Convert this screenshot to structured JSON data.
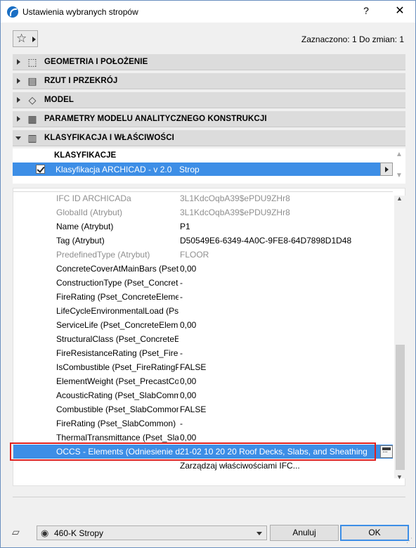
{
  "window": {
    "title": "Ustawienia wybranych stropów",
    "help": "?",
    "close": "✕"
  },
  "toolbar": {
    "favorites_icon": "star-icon",
    "selected_info": "Zaznaczono: 1 Do zmian: 1"
  },
  "panels": [
    {
      "label": "GEOMETRIA I POŁOŻENIE",
      "icon": "geometry-icon",
      "expanded": false
    },
    {
      "label": "RZUT I PRZEKRÓJ",
      "icon": "floorplan-icon",
      "expanded": false
    },
    {
      "label": "MODEL",
      "icon": "model-icon",
      "expanded": false
    },
    {
      "label": "PARAMETRY MODELU ANALITYCZNEGO KONSTRUKCJI",
      "icon": "analytical-icon",
      "expanded": false
    },
    {
      "label": "KLASYFIKACJA I WŁAŚCIWOŚCI",
      "icon": "properties-icon",
      "expanded": true
    }
  ],
  "classification": {
    "heading": "KLASYFIKACJE",
    "row": {
      "name": "Klasyfikacja ARCHICAD - v 2.0",
      "value": "Strop",
      "checked": true
    }
  },
  "properties": [
    {
      "name": "IFC ID ARCHICADa",
      "value": "3L1KdcOqbA39$ePDU9ZHr8",
      "disabled": true
    },
    {
      "name": "GlobalId (Atrybut)",
      "value": "3L1KdcOqbA39$ePDU9ZHr8",
      "disabled": true
    },
    {
      "name": "Name (Atrybut)",
      "value": "P1",
      "disabled": false
    },
    {
      "name": "Tag (Atrybut)",
      "value": "D50549E6-6349-4A0C-9FE8-64D7898D1D48",
      "disabled": false
    },
    {
      "name": "PredefinedType (Atrybut)",
      "value": "FLOOR",
      "disabled": true
    },
    {
      "name": "ConcreteCoverAtMainBars (Pset_ConcreteElementGeneral)",
      "value": " 0,00",
      "disabled": false
    },
    {
      "name": "ConstructionType (Pset_ConcreteElementGeneral)",
      "value": "-",
      "disabled": false
    },
    {
      "name": "FireRating (Pset_ConcreteElementGeneral)",
      "value": "-",
      "disabled": false
    },
    {
      "name": "LifeCycleEnvironmentalLoad (Pset_ConcreteElementGeneral)",
      "value": "",
      "disabled": false
    },
    {
      "name": "ServiceLife (Pset_ConcreteElementGeneral)",
      "value": " 0,00",
      "disabled": false
    },
    {
      "name": "StructuralClass (Pset_ConcreteElementGeneral)",
      "value": "",
      "disabled": false
    },
    {
      "name": "FireResistanceRating (Pset_FireRatingProperties)",
      "value": "-",
      "disabled": false
    },
    {
      "name": "IsCombustible (Pset_FireRatingProperties)",
      "value": "FALSE",
      "disabled": false
    },
    {
      "name": "ElementWeight (Pset_PrecastConcreteElementGeneral)",
      "value": " 0,00",
      "disabled": false
    },
    {
      "name": "AcousticRating (Pset_SlabCommon)",
      "value": "0,00",
      "disabled": false
    },
    {
      "name": "Combustible (Pset_SlabCommon)",
      "value": "FALSE",
      "disabled": false
    },
    {
      "name": "FireRating (Pset_SlabCommon)",
      "value": "-",
      "disabled": false
    },
    {
      "name": "ThermalTransmittance (Pset_SlabCommon)",
      "value": " 0,00",
      "disabled": false
    }
  ],
  "selected_property": {
    "name": "OCCS - Elements (Odniesienie do klasyfikacji)",
    "value": "21-02 10 20 20 Roof Decks, Slabs, and Sheathing"
  },
  "manage_link": "Zarządzaj właściwościami IFC...",
  "footer": {
    "layer_icon": "layer-icon",
    "eye_icon": "eye-icon",
    "layer": "460-K Stropy",
    "cancel": "Anuluj",
    "ok": "OK"
  },
  "colors": {
    "selection": "#3d8ee6",
    "highlight_frame": "#e0201e"
  }
}
